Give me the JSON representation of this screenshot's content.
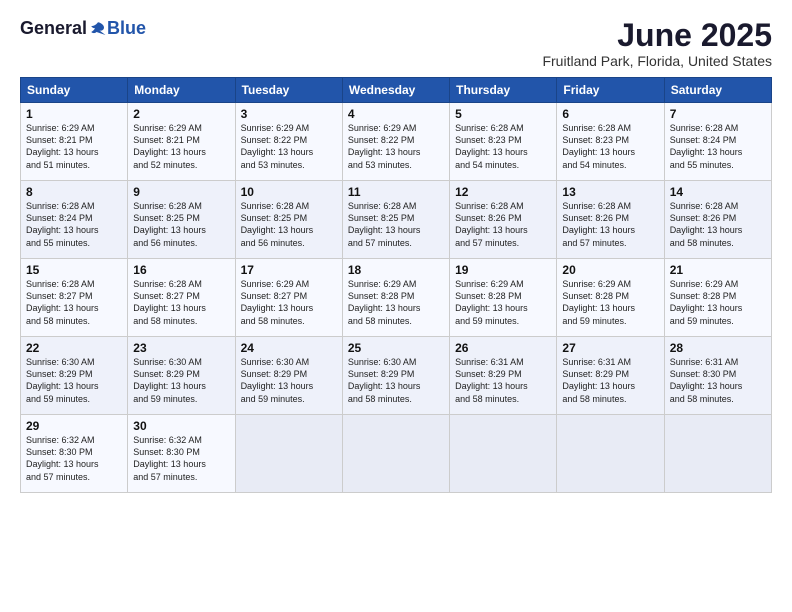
{
  "logo": {
    "general": "General",
    "blue": "Blue"
  },
  "title": "June 2025",
  "subtitle": "Fruitland Park, Florida, United States",
  "days_of_week": [
    "Sunday",
    "Monday",
    "Tuesday",
    "Wednesday",
    "Thursday",
    "Friday",
    "Saturday"
  ],
  "weeks": [
    [
      {
        "day": "1",
        "sunrise": "6:29 AM",
        "sunset": "8:21 PM",
        "daylight": "13 hours and 51 minutes."
      },
      {
        "day": "2",
        "sunrise": "6:29 AM",
        "sunset": "8:21 PM",
        "daylight": "13 hours and 52 minutes."
      },
      {
        "day": "3",
        "sunrise": "6:29 AM",
        "sunset": "8:22 PM",
        "daylight": "13 hours and 53 minutes."
      },
      {
        "day": "4",
        "sunrise": "6:29 AM",
        "sunset": "8:22 PM",
        "daylight": "13 hours and 53 minutes."
      },
      {
        "day": "5",
        "sunrise": "6:28 AM",
        "sunset": "8:23 PM",
        "daylight": "13 hours and 54 minutes."
      },
      {
        "day": "6",
        "sunrise": "6:28 AM",
        "sunset": "8:23 PM",
        "daylight": "13 hours and 54 minutes."
      },
      {
        "day": "7",
        "sunrise": "6:28 AM",
        "sunset": "8:24 PM",
        "daylight": "13 hours and 55 minutes."
      }
    ],
    [
      {
        "day": "8",
        "sunrise": "6:28 AM",
        "sunset": "8:24 PM",
        "daylight": "13 hours and 55 minutes."
      },
      {
        "day": "9",
        "sunrise": "6:28 AM",
        "sunset": "8:25 PM",
        "daylight": "13 hours and 56 minutes."
      },
      {
        "day": "10",
        "sunrise": "6:28 AM",
        "sunset": "8:25 PM",
        "daylight": "13 hours and 56 minutes."
      },
      {
        "day": "11",
        "sunrise": "6:28 AM",
        "sunset": "8:25 PM",
        "daylight": "13 hours and 57 minutes."
      },
      {
        "day": "12",
        "sunrise": "6:28 AM",
        "sunset": "8:26 PM",
        "daylight": "13 hours and 57 minutes."
      },
      {
        "day": "13",
        "sunrise": "6:28 AM",
        "sunset": "8:26 PM",
        "daylight": "13 hours and 57 minutes."
      },
      {
        "day": "14",
        "sunrise": "6:28 AM",
        "sunset": "8:26 PM",
        "daylight": "13 hours and 58 minutes."
      }
    ],
    [
      {
        "day": "15",
        "sunrise": "6:28 AM",
        "sunset": "8:27 PM",
        "daylight": "13 hours and 58 minutes."
      },
      {
        "day": "16",
        "sunrise": "6:28 AM",
        "sunset": "8:27 PM",
        "daylight": "13 hours and 58 minutes."
      },
      {
        "day": "17",
        "sunrise": "6:29 AM",
        "sunset": "8:27 PM",
        "daylight": "13 hours and 58 minutes."
      },
      {
        "day": "18",
        "sunrise": "6:29 AM",
        "sunset": "8:28 PM",
        "daylight": "13 hours and 58 minutes."
      },
      {
        "day": "19",
        "sunrise": "6:29 AM",
        "sunset": "8:28 PM",
        "daylight": "13 hours and 59 minutes."
      },
      {
        "day": "20",
        "sunrise": "6:29 AM",
        "sunset": "8:28 PM",
        "daylight": "13 hours and 59 minutes."
      },
      {
        "day": "21",
        "sunrise": "6:29 AM",
        "sunset": "8:28 PM",
        "daylight": "13 hours and 59 minutes."
      }
    ],
    [
      {
        "day": "22",
        "sunrise": "6:30 AM",
        "sunset": "8:29 PM",
        "daylight": "13 hours and 59 minutes."
      },
      {
        "day": "23",
        "sunrise": "6:30 AM",
        "sunset": "8:29 PM",
        "daylight": "13 hours and 59 minutes."
      },
      {
        "day": "24",
        "sunrise": "6:30 AM",
        "sunset": "8:29 PM",
        "daylight": "13 hours and 59 minutes."
      },
      {
        "day": "25",
        "sunrise": "6:30 AM",
        "sunset": "8:29 PM",
        "daylight": "13 hours and 58 minutes."
      },
      {
        "day": "26",
        "sunrise": "6:31 AM",
        "sunset": "8:29 PM",
        "daylight": "13 hours and 58 minutes."
      },
      {
        "day": "27",
        "sunrise": "6:31 AM",
        "sunset": "8:29 PM",
        "daylight": "13 hours and 58 minutes."
      },
      {
        "day": "28",
        "sunrise": "6:31 AM",
        "sunset": "8:30 PM",
        "daylight": "13 hours and 58 minutes."
      }
    ],
    [
      {
        "day": "29",
        "sunrise": "6:32 AM",
        "sunset": "8:30 PM",
        "daylight": "13 hours and 57 minutes."
      },
      {
        "day": "30",
        "sunrise": "6:32 AM",
        "sunset": "8:30 PM",
        "daylight": "13 hours and 57 minutes."
      },
      null,
      null,
      null,
      null,
      null
    ]
  ],
  "labels": {
    "sunrise": "Sunrise:",
    "sunset": "Sunset:",
    "daylight": "Daylight:"
  }
}
